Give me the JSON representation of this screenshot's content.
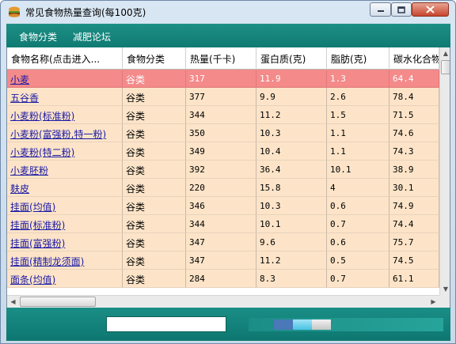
{
  "window": {
    "title": "常见食物热量查询(每100克)"
  },
  "menu": {
    "foods": "食物分类",
    "forum": "减肥论坛"
  },
  "table": {
    "columns": [
      "食物名称(点击进入...",
      "食物分类",
      "热量(千卡)",
      "蛋白质(克)",
      "脂肪(克)",
      "碳水化合物"
    ],
    "selected_index": 0,
    "rows": [
      [
        "小麦",
        "谷类",
        "317",
        "11.9",
        "1.3",
        "64.4"
      ],
      [
        "五谷香",
        "谷类",
        "377",
        "9.9",
        "2.6",
        "78.4"
      ],
      [
        "小麦粉(标准粉)",
        "谷类",
        "344",
        "11.2",
        "1.5",
        "71.5"
      ],
      [
        "小麦粉(富强粉,特一粉)",
        "谷类",
        "350",
        "10.3",
        "1.1",
        "74.6"
      ],
      [
        "小麦粉(特二粉)",
        "谷类",
        "349",
        "10.4",
        "1.1",
        "74.3"
      ],
      [
        "小麦胚粉",
        "谷类",
        "392",
        "36.4",
        "10.1",
        "38.9"
      ],
      [
        "麸皮",
        "谷类",
        "220",
        "15.8",
        "4",
        "30.1"
      ],
      [
        "挂面(均值)",
        "谷类",
        "346",
        "10.3",
        "0.6",
        "74.9"
      ],
      [
        "挂面(标准粉)",
        "谷类",
        "344",
        "10.1",
        "0.7",
        "74.4"
      ],
      [
        "挂面(富强粉)",
        "谷类",
        "347",
        "9.6",
        "0.6",
        "75.7"
      ],
      [
        "挂面(精制龙须面)",
        "谷类",
        "347",
        "11.2",
        "0.5",
        "74.5"
      ],
      [
        "面条(均值)",
        "谷类",
        "284",
        "8.3",
        "0.7",
        "61.1"
      ]
    ]
  },
  "statusbar": {
    "text": "",
    "progress": 0.46
  },
  "colors": {
    "teal": "#0f7b73",
    "row_bg": "#fde4c8",
    "selected_bg": "#f48a8a",
    "link": "#1a1aa6"
  }
}
